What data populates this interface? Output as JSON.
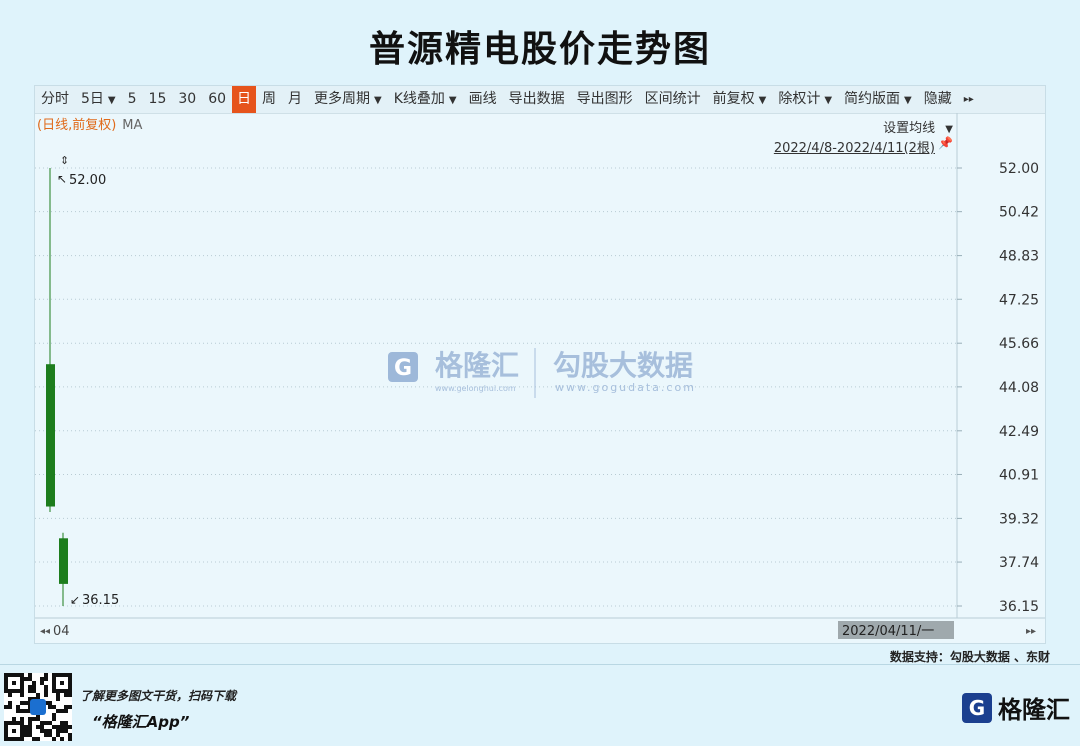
{
  "title": "普源精电股价走势图",
  "toolbar": {
    "items": [
      "分时",
      "5日",
      "5",
      "15",
      "30",
      "60",
      "日",
      "周",
      "月",
      "更多周期",
      "K线叠加",
      "画线",
      "导出数据",
      "导出图形",
      "区间统计",
      "前复权",
      "除权计",
      "简约版面",
      "隐藏"
    ],
    "active_index": 6,
    "dropdown_indices": [
      1,
      9,
      10,
      15,
      16,
      17
    ]
  },
  "subheader": {
    "mode": "(日线,前复权)",
    "indicator": "MA",
    "ma_setting": "设置均线",
    "range": "2022/4/8-2022/4/11(2根)"
  },
  "watermark": {
    "brand1": "格隆汇",
    "brand1_url": "www.gelonghui.com",
    "brand2": "勾股大数据",
    "brand2_url": "www.gogudata.com"
  },
  "chart_data": {
    "type": "candlestick",
    "title": "普源精电股价走势图",
    "y_ticks": [
      "52.00",
      "50.42",
      "48.83",
      "47.25",
      "45.66",
      "44.08",
      "42.49",
      "40.91",
      "39.32",
      "37.74",
      "36.15"
    ],
    "ylim": [
      36.15,
      52.0
    ],
    "candles": [
      {
        "date": "2022/4/8",
        "open": 44.9,
        "high": 52.0,
        "low": 39.55,
        "close": 39.75,
        "color": "#1d7d1d"
      },
      {
        "date": "2022/4/11",
        "open": 38.6,
        "high": 38.8,
        "low": 36.15,
        "close": 36.95,
        "color": "#1d7d1d"
      }
    ],
    "annotations": {
      "high_label": "52.00",
      "low_label": "36.15"
    },
    "x_start_label": "04",
    "x_end_label": "2022/04/11/一"
  },
  "colors": {
    "down": "#1d7d1d",
    "active": "#e6541c",
    "end_label_bg": "#9fa9ad"
  },
  "footer": {
    "source": "数据支持：勾股大数据 、东财",
    "promo_line1": "了解更多图文干货，扫码下载",
    "promo_line2": "“格隆汇App”",
    "brand": "格隆汇",
    "brand_logo_glyph": "G"
  }
}
